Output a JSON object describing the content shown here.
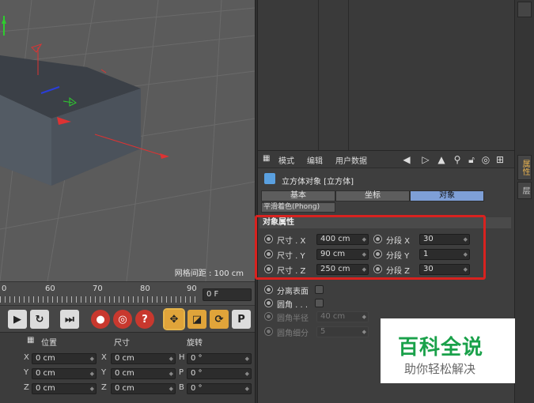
{
  "viewport": {
    "grid_label": "网格间距 : 100 cm"
  },
  "timeline": {
    "ticks": [
      "0",
      "60",
      "70",
      "80",
      "90"
    ],
    "frame_value": "0 F"
  },
  "coord": {
    "headers": {
      "position": "位置",
      "size": "尺寸",
      "rotation": "旋转"
    },
    "rows": [
      {
        "a1": "X",
        "v1": "0 cm",
        "a2": "X",
        "v2": "0 cm",
        "a3": "H",
        "v3": "0 °"
      },
      {
        "a1": "Y",
        "v1": "0 cm",
        "a2": "Y",
        "v2": "0 cm",
        "a3": "P",
        "v3": "0 °"
      },
      {
        "a1": "Z",
        "v1": "0 cm",
        "a2": "Z",
        "v2": "0 cm",
        "a3": "B",
        "v3": "0 °"
      }
    ]
  },
  "attr": {
    "menu": {
      "mode": "模式",
      "edit": "编辑",
      "userdata": "用户数据"
    },
    "object_title": "立方体对象 [立方体]",
    "tabs": {
      "basic": "基本",
      "coord": "坐标",
      "object": "对象"
    },
    "phong_tab": "平滑着色(Phong)",
    "section": "对象属性",
    "size_rows": [
      {
        "label": "尺寸 . X",
        "value": "400 cm",
        "seg_label": "分段 X",
        "seg_value": "30"
      },
      {
        "label": "尺寸 . Y",
        "value": "90 cm",
        "seg_label": "分段 Y",
        "seg_value": "1"
      },
      {
        "label": "尺寸 . Z",
        "value": "250 cm",
        "seg_label": "分段 Z",
        "seg_value": "30"
      }
    ],
    "separate_surfaces": "分离表面",
    "fillet": "圆角 . . .",
    "fillet_radius_label": "圆角半径",
    "fillet_radius_value": "40 cm",
    "fillet_subdiv_label": "圆角细分",
    "fillet_subdiv_value": "5"
  },
  "side_tabs": {
    "attr": "属性",
    "layer": "层"
  },
  "watermark": {
    "title": "百科全说",
    "subtitle": "助你轻松解决"
  }
}
